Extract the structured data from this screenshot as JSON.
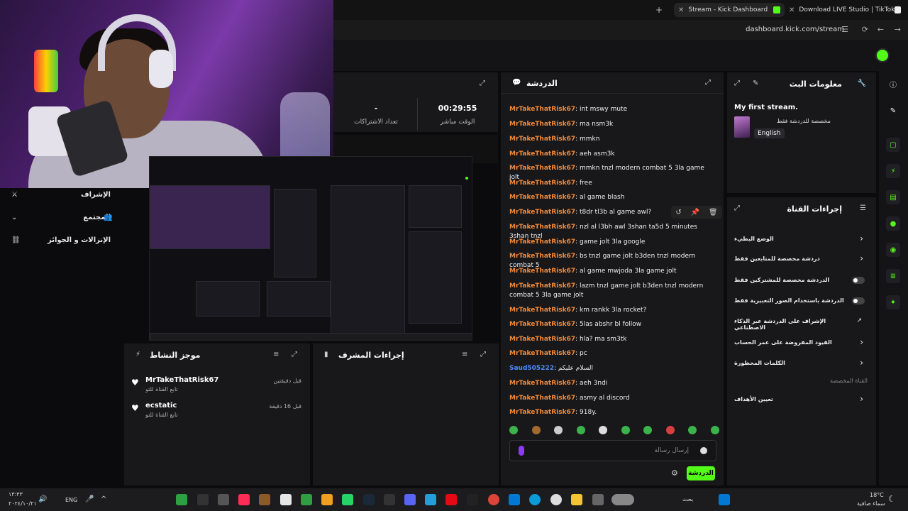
{
  "browser": {
    "tabs": [
      {
        "label": "Stream - Kick Dashboard",
        "active": true
      },
      {
        "label": "Download LIVE Studio | TikTok",
        "active": false
      }
    ],
    "url": "dashboard.kick.com/stream"
  },
  "stats": {
    "items": [
      {
        "value": "00:29:55",
        "label": "الوقت مباشر"
      },
      {
        "value": "-",
        "label": "تعداد الاشتراكات"
      }
    ]
  },
  "sidebar": {
    "items": [
      {
        "label": "الإشراف"
      },
      {
        "label": "المجتمع"
      },
      {
        "label": "الإنزالات و الجوائز"
      }
    ]
  },
  "activity": {
    "title": "موجز النشاط",
    "items": [
      {
        "name": "MrTakeThatRisk67",
        "sub": "تابع القناة للتو",
        "time": "قبل دقيقتين"
      },
      {
        "name": "ecstatic",
        "sub": "تابع القناة للتو",
        "time": "قبل 16 دقيقة"
      }
    ]
  },
  "moderation": {
    "title": "إجراءات المشرف"
  },
  "chat": {
    "title": "الدردشة",
    "messages": [
      {
        "user": "MrTakeThatRisk67",
        "text": "int mswy mute",
        "color": "#f08a3c"
      },
      {
        "user": "MrTakeThatRisk67",
        "text": "ma nsm3k",
        "color": "#f08a3c"
      },
      {
        "user": "MrTakeThatRisk67",
        "text": "mmkn",
        "color": "#f08a3c"
      },
      {
        "user": "MrTakeThatRisk67",
        "text": "aeh asm3k",
        "color": "#f08a3c"
      },
      {
        "user": "MrTakeThatRisk67",
        "text": "mmkn tnzl modern combat 5 3la game jolt",
        "color": "#f08a3c"
      },
      {
        "user": "MrTakeThatRisk67",
        "text": "free",
        "color": "#f08a3c"
      },
      {
        "user": "MrTakeThatRisk67",
        "text": "al game blash",
        "color": "#f08a3c"
      },
      {
        "user": "MrTakeThatRisk67",
        "text": "t8dr tl3b al game awl?",
        "color": "#f08a3c"
      },
      {
        "user": "MrTakeThatRisk67",
        "text": "nzl al l3bh awl 3shan ta5d 5 minutes 3shan tnzl",
        "color": "#f08a3c"
      },
      {
        "user": "MrTakeThatRisk67",
        "text": "game jolt 3la google",
        "color": "#f08a3c"
      },
      {
        "user": "MrTakeThatRisk67",
        "text": "bs tnzl game jolt b3den tnzl modern combat 5",
        "color": "#f08a3c"
      },
      {
        "user": "MrTakeThatRisk67",
        "text": "al game mwjoda 3la game jolt",
        "color": "#f08a3c"
      },
      {
        "user": "MrTakeThatRisk67",
        "text": "lazm tnzl game jolt b3den tnzl modern combat 5 3la game jolt",
        "color": "#f08a3c"
      },
      {
        "user": "MrTakeThatRisk67",
        "text": "km rankk 3la rocket?",
        "color": "#f08a3c"
      },
      {
        "user": "MrTakeThatRisk67",
        "text": "5las abshr bl follow",
        "color": "#f08a3c"
      },
      {
        "user": "MrTakeThatRisk67",
        "text": "hla? ma sm3tk",
        "color": "#f08a3c"
      },
      {
        "user": "MrTakeThatRisk67",
        "text": "pc",
        "color": "#f08a3c"
      },
      {
        "user": "Saud505222",
        "text": "السلام عليكم",
        "color": "#4d8cff"
      },
      {
        "user": "MrTakeThatRisk67",
        "text": "aeh 3ndi",
        "color": "#f08a3c"
      },
      {
        "user": "MrTakeThatRisk67",
        "text": "asmy al discord",
        "color": "#f08a3c"
      },
      {
        "user": "MrTakeThatRisk67",
        "text": "918y.",
        "color": "#f08a3c"
      }
    ],
    "input_placeholder": "إرسال رسالة",
    "send_label": "الدردشة"
  },
  "stream_info": {
    "title": "معلومات البث",
    "stream_title": "My first stream.",
    "category": "مخصصة للدردشة فقط",
    "language": "English"
  },
  "channel_actions": {
    "title": "إجراءات القناة",
    "items": [
      {
        "label": "الوضع البطيء",
        "control": "chevron"
      },
      {
        "label": "دردشة مخصصة للمتابعين فقط",
        "control": "chevron"
      },
      {
        "label": "الدردشة مخصصة للمشتركين فقط",
        "control": "toggle"
      },
      {
        "label": "الدردشة باستخدام الصور التعبيرية فقط",
        "control": "toggle"
      },
      {
        "label": "الإشراف على الدردشة عبر الذكاء الاصطناعي",
        "control": "external"
      },
      {
        "label": "القيود المفروضة على عمر الحساب",
        "control": "chevron"
      },
      {
        "label": "الكلمات المحظورة",
        "control": "chevron"
      }
    ],
    "section_label": "القناة المخصصة",
    "goals_label": "تعيين الأهداف"
  },
  "taskbar": {
    "time": "١٣:٣٣",
    "date": "٢٠٢٤/١٠/٢١",
    "lang": "ENG",
    "search": "بحث",
    "weather_temp": "18°C",
    "weather_desc": "سماء صافية"
  },
  "colors": {
    "accent": "#53fc18",
    "panel": "#18181b",
    "username": "#f08a3c"
  }
}
